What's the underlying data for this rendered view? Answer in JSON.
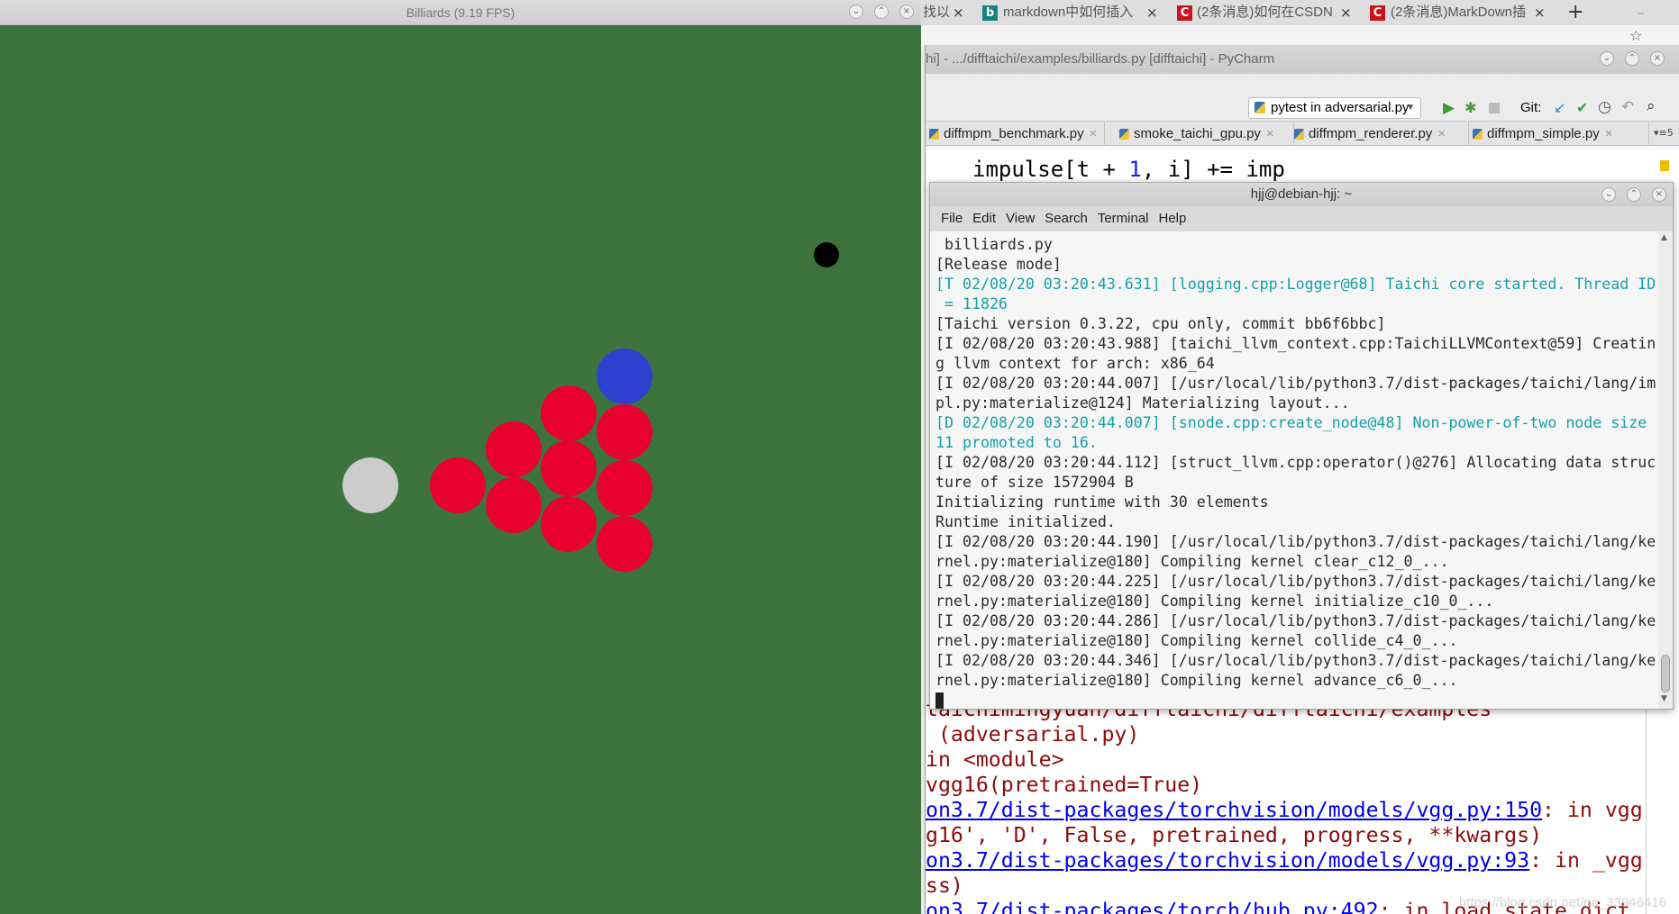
{
  "billiards": {
    "title": "Billiards (9.19 FPS)",
    "table_color": "#3d743e",
    "balls": [
      {
        "kind": "cue",
        "color": "#cccccc"
      },
      {
        "kind": "black",
        "color": "#000000"
      },
      {
        "kind": "blue",
        "color": "#2f3fcf"
      },
      {
        "kind": "red",
        "color": "#e8002e"
      }
    ]
  },
  "browser": {
    "tabs": [
      {
        "label": "找以/"
      },
      {
        "label": "markdown中如何插入",
        "icon": "b"
      },
      {
        "label": "(2条消息)如何在CSDN",
        "icon": "C"
      },
      {
        "label": "(2条消息)MarkDown插",
        "icon": "C"
      }
    ],
    "new_tab": "+"
  },
  "pycharm": {
    "title": "hi] - .../difftaichi/examples/billiards.py [difftaichi] - PyCharm",
    "run_config": "pytest in adversarial.py",
    "git_label": "Git:",
    "file_tabs": [
      "diffmpm_benchmark.py",
      "smoke_taichi_gpu.py",
      "diffmpm_renderer.py",
      "diffmpm_simple.py"
    ],
    "tabs_overflow": "5",
    "code_line": {
      "a": "impulse[t + ",
      "num": "1",
      "b": ", i] += imp"
    },
    "output": [
      {
        "text": "taichimingyuan/difftaichi/difftaichi/examples"
      },
      {
        "text": " (adversarial.py)"
      },
      {
        "text": "in <module>"
      },
      {
        "text": "vgg16(pretrained=True)"
      },
      {
        "link": "on3.7/dist-packages/torchvision/models/vgg.py:150",
        "text": ": in vgg"
      },
      {
        "text": "g16', 'D', False, pretrained, progress, **kwargs)"
      },
      {
        "link": "on3.7/dist-packages/torchvision/models/vgg.py:93",
        "text": ": in _vgg"
      },
      {
        "text": "ss)"
      },
      {
        "link": "on3.7/dist-packages/torch/hub.py:492",
        "text": ": in load_state_dict"
      }
    ],
    "watermark": "https://blog.csdn.net/qq_33946416"
  },
  "terminal": {
    "title": "hjj@debian-hjj: ~",
    "menu": [
      "File",
      "Edit",
      "View",
      "Search",
      "Terminal",
      "Help"
    ],
    "lines": [
      {
        "t": " billiards.py",
        "c": ""
      },
      {
        "t": "[Release mode]",
        "c": ""
      },
      {
        "t": "[T 02/08/20 03:20:43.631] [logging.cpp:Logger@68] Taichi core started. Thread ID",
        "c": "teal"
      },
      {
        "t": " = 11826",
        "c": "teal"
      },
      {
        "t": "[Taichi version 0.3.22, cpu only, commit bb6f6bbc]",
        "c": ""
      },
      {
        "t": "[I 02/08/20 03:20:43.988] [taichi_llvm_context.cpp:TaichiLLVMContext@59] Creatin",
        "c": ""
      },
      {
        "t": "g llvm context for arch: x86_64",
        "c": ""
      },
      {
        "t": "[I 02/08/20 03:20:44.007] [/usr/local/lib/python3.7/dist-packages/taichi/lang/im",
        "c": ""
      },
      {
        "t": "pl.py:materialize@124] Materializing layout...",
        "c": ""
      },
      {
        "t": "[D 02/08/20 03:20:44.007] [snode.cpp:create_node@48] Non-power-of-two node size",
        "c": "teal"
      },
      {
        "t": "11 promoted to 16.",
        "c": "teal"
      },
      {
        "t": "[I 02/08/20 03:20:44.112] [struct_llvm.cpp:operator()@276] Allocating data struc",
        "c": ""
      },
      {
        "t": "ture of size 1572904 B",
        "c": ""
      },
      {
        "t": "Initializing runtime with 30 elements",
        "c": ""
      },
      {
        "t": "Runtime initialized.",
        "c": ""
      },
      {
        "t": "[I 02/08/20 03:20:44.190] [/usr/local/lib/python3.7/dist-packages/taichi/lang/ke",
        "c": ""
      },
      {
        "t": "rnel.py:materialize@180] Compiling kernel clear_c12_0_...",
        "c": ""
      },
      {
        "t": "[I 02/08/20 03:20:44.225] [/usr/local/lib/python3.7/dist-packages/taichi/lang/ke",
        "c": ""
      },
      {
        "t": "rnel.py:materialize@180] Compiling kernel initialize_c10_0_...",
        "c": ""
      },
      {
        "t": "[I 02/08/20 03:20:44.286] [/usr/local/lib/python3.7/dist-packages/taichi/lang/ke",
        "c": ""
      },
      {
        "t": "rnel.py:materialize@180] Compiling kernel collide_c4_0_...",
        "c": ""
      },
      {
        "t": "[I 02/08/20 03:20:44.346] [/usr/local/lib/python3.7/dist-packages/taichi/lang/ke",
        "c": ""
      },
      {
        "t": "rnel.py:materialize@180] Compiling kernel advance_c6_0_...",
        "c": ""
      }
    ]
  }
}
